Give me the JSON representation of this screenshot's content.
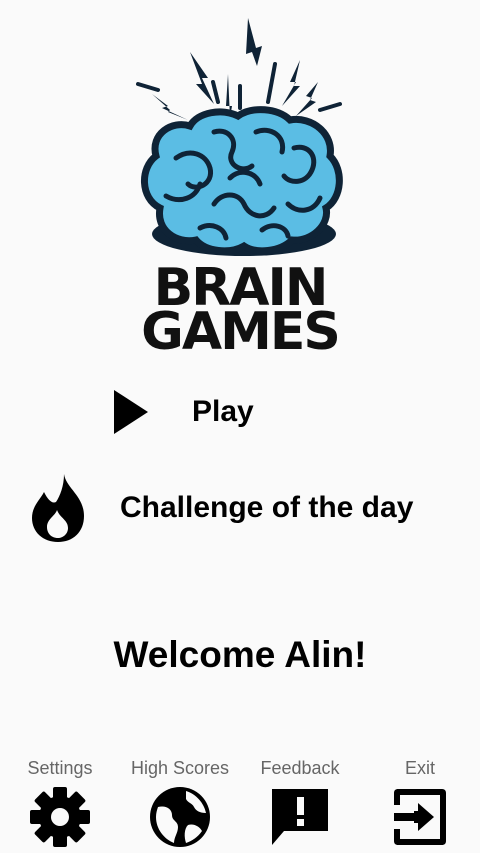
{
  "app": {
    "logo": {
      "line1": "BRAIN",
      "line2": "GAMES"
    }
  },
  "menu": {
    "play": {
      "label": "Play",
      "icon": "play-icon"
    },
    "challenge": {
      "label": "Challenge of the day",
      "icon": "flame-icon"
    }
  },
  "welcome": {
    "text": "Welcome Alin!"
  },
  "bottom_nav": {
    "settings": {
      "label": "Settings",
      "icon": "gear-icon"
    },
    "high_scores": {
      "label": "High Scores",
      "icon": "globe-icon"
    },
    "feedback": {
      "label": "Feedback",
      "icon": "feedback-icon"
    },
    "exit": {
      "label": "Exit",
      "icon": "exit-icon"
    }
  },
  "colors": {
    "background": "#fafafa",
    "brain_fill": "#5bbde4",
    "brain_stroke": "#0f2336",
    "text": "#000000",
    "nav_label": "#666666"
  }
}
